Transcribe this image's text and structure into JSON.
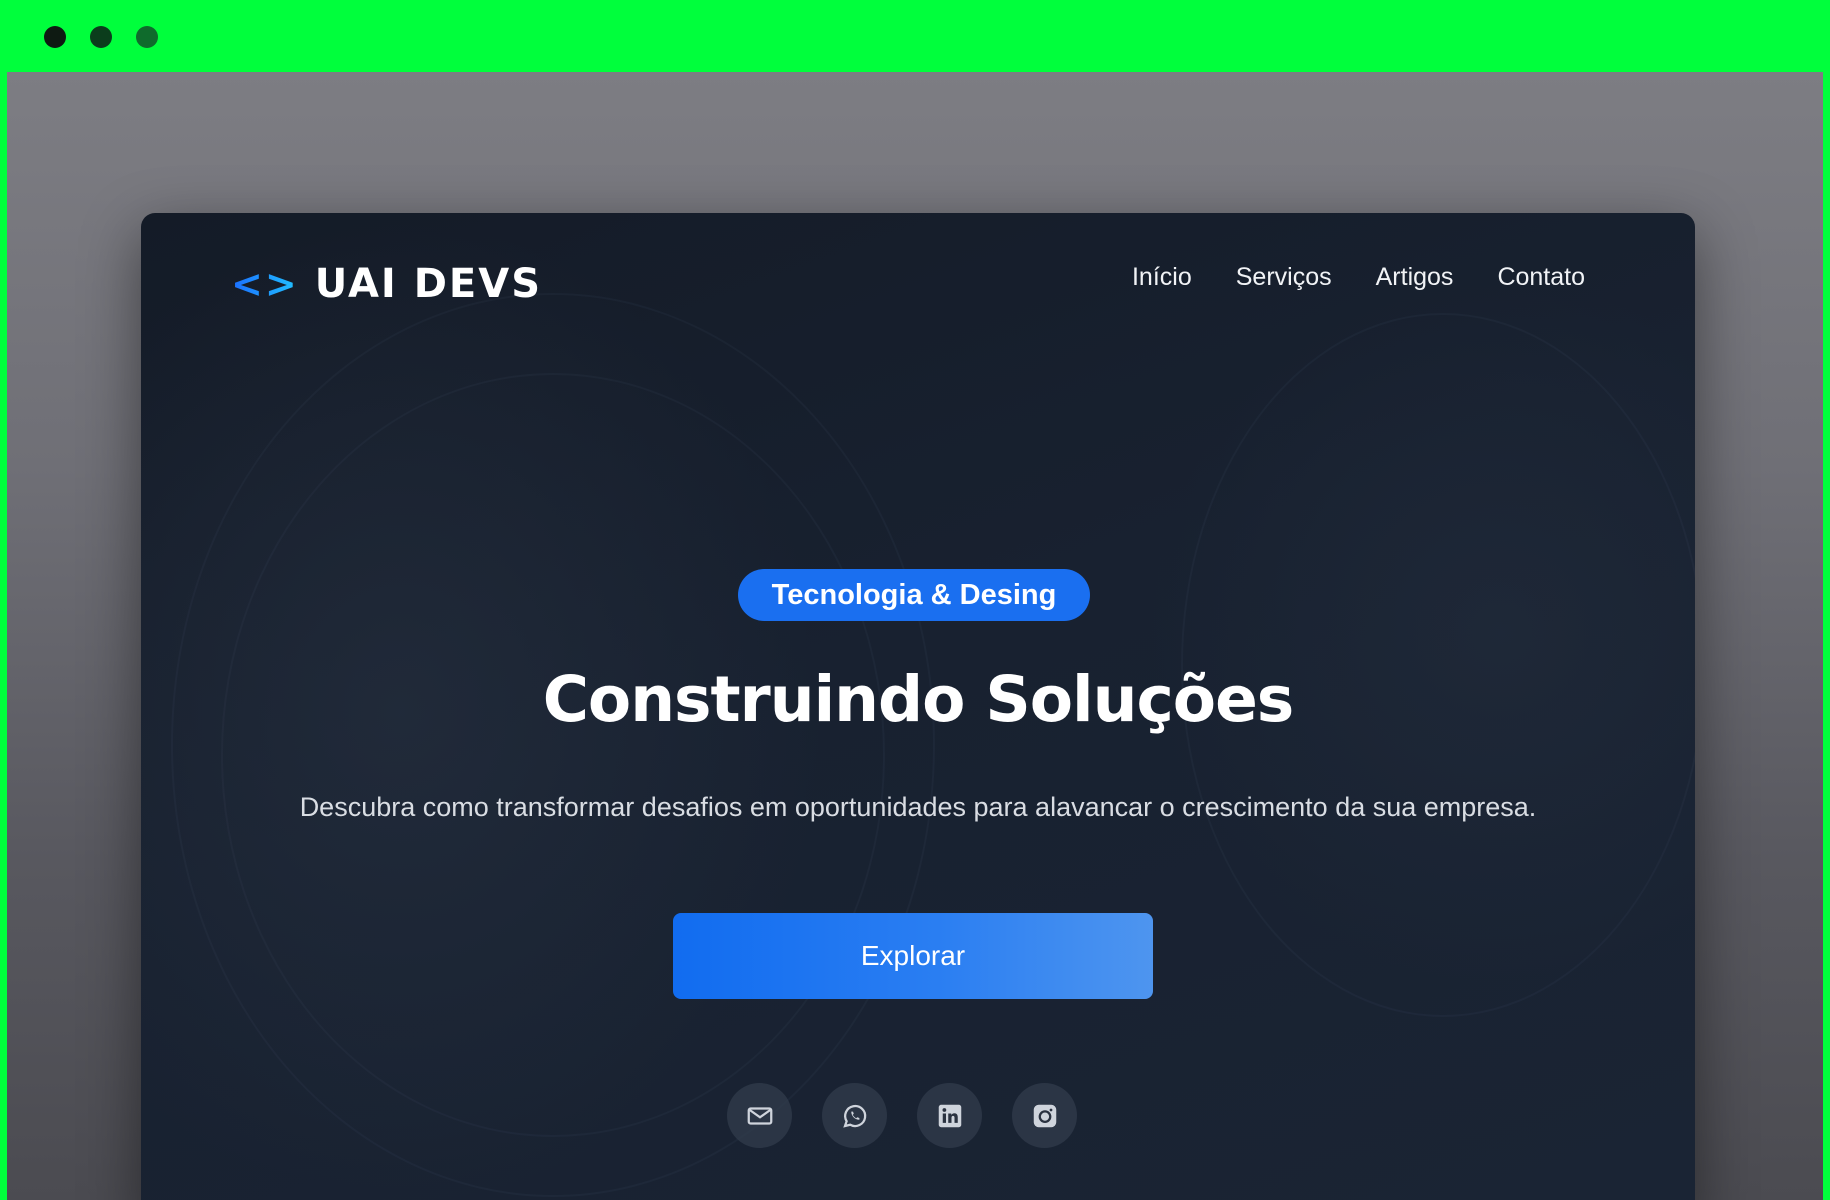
{
  "window": {
    "dots": [
      "close-dot",
      "minimize-dot",
      "maximize-dot"
    ]
  },
  "brand": {
    "mark": "<>",
    "name": "UAI DEVS"
  },
  "nav": {
    "items": [
      "Início",
      "Serviços",
      "Artigos",
      "Contato"
    ]
  },
  "hero": {
    "badge": "Tecnologia & Desing",
    "title": "Construindo Soluções",
    "subtitle": "Descubra como transformar desafios em oportunidades para alavancar o crescimento da sua empresa.",
    "cta": "Explorar"
  },
  "socials": [
    "mail-icon",
    "whatsapp-icon",
    "linkedin-icon",
    "instagram-icon"
  ],
  "colors": {
    "window_chrome": "#00ff3c",
    "accent": "#1a6ff0",
    "card_bg": "#182130"
  }
}
